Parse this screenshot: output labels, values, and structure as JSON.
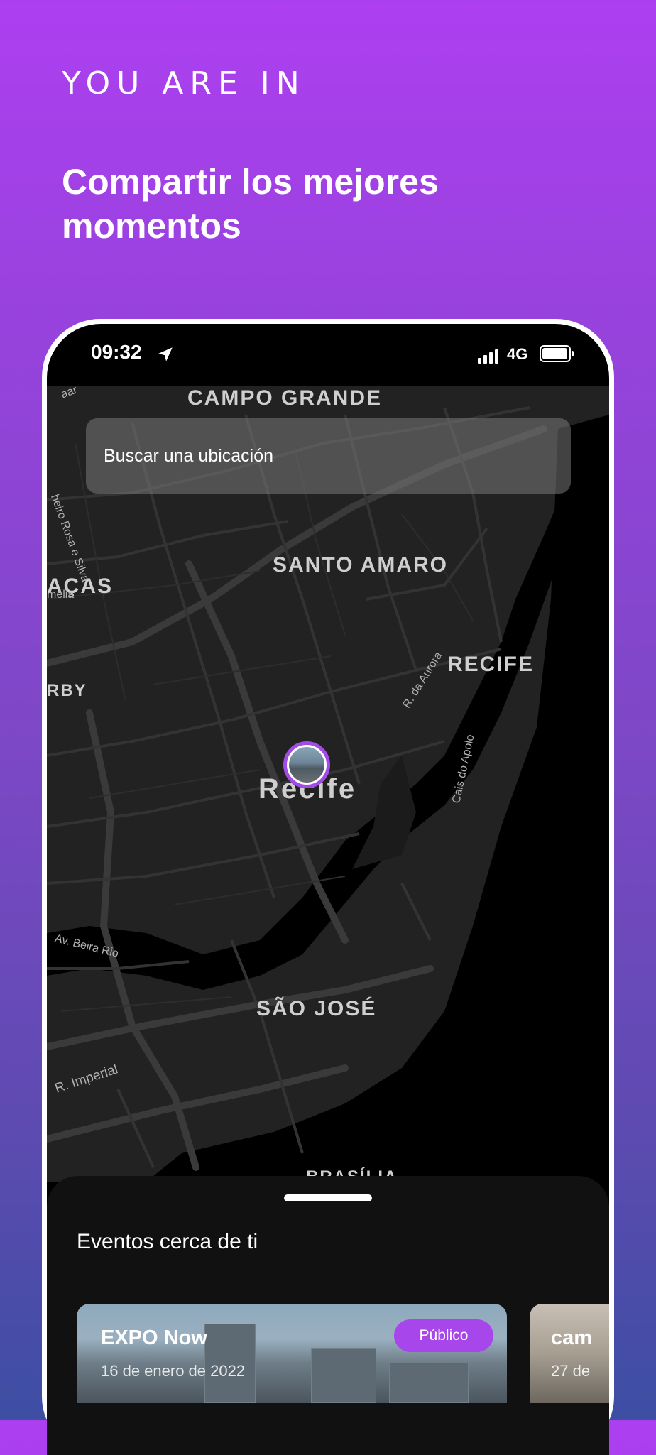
{
  "header": {
    "eyebrow": "YOU ARE IN",
    "headline": "Compartir los mejores momentos"
  },
  "status_bar": {
    "time": "09:32",
    "network": "4G"
  },
  "search": {
    "placeholder": "Buscar una ubicación"
  },
  "map": {
    "labels": {
      "campo_grande": "CAMPO GRANDE",
      "santo_amaro": "SANTO AMARO",
      "gracas": "AÇAS",
      "recife_district": "RECIFE",
      "derby": "RBY",
      "recife_city": "Recife",
      "sao_jose": "SÃO JOSÉ",
      "brasilia": "BRASÍLIA",
      "rosa_e_silva": "heiro Rosa e Silva",
      "amelia": "mélia",
      "rua_aurora": "R. da Aurora",
      "cais_apolo": "Cais do Apolo",
      "beira_rio": "Av. Beira Rio",
      "imperial": "R. Imperial",
      "top_fragment": "aar"
    }
  },
  "events": {
    "title": "Eventos cerca de ti",
    "cards": [
      {
        "name": "EXPO Now",
        "date": "16 de enero de 2022",
        "badge": "Público"
      },
      {
        "name": "cam",
        "date": "27 de"
      }
    ]
  },
  "colors": {
    "accent": "#a746ea",
    "gradient_top": "#ad3ff1",
    "gradient_bottom": "#3d4ea3"
  }
}
